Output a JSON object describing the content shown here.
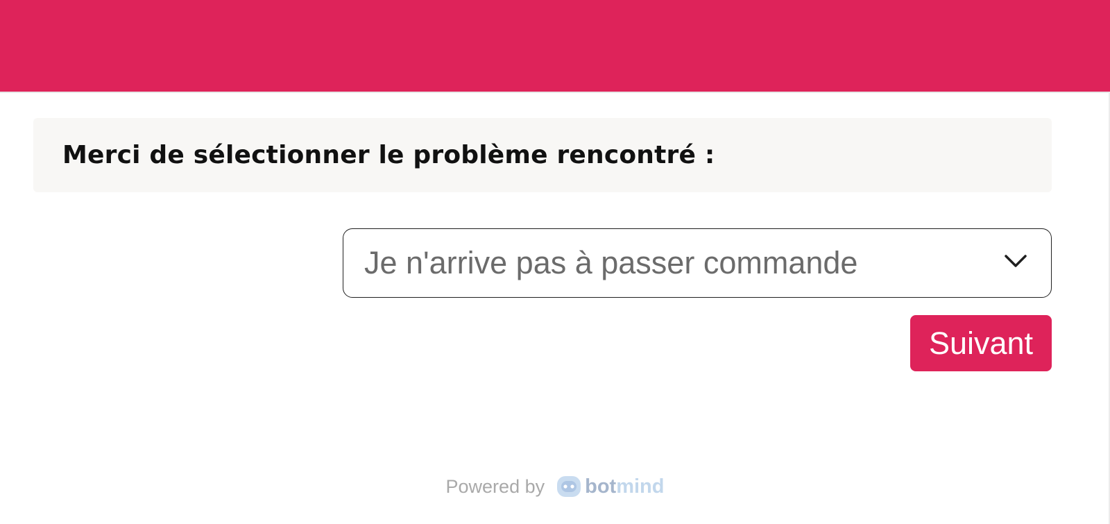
{
  "theme": {
    "accent": "#de235a",
    "card_background": "#f8f7f5",
    "footer_text": "#a9a9a9",
    "brand_dark": "#a5b5cc",
    "brand_light": "#c2d7ec"
  },
  "form": {
    "question": "Merci de sélectionner le problème rencontré :",
    "select": {
      "value": "Je n'arrive pas à passer commande",
      "icon": "chevron-down-icon"
    },
    "next_label": "Suivant"
  },
  "footer": {
    "powered_by": "Powered by",
    "brand_prefix": "bot",
    "brand_suffix": "mind",
    "brand_icon": "bot-face-icon"
  }
}
